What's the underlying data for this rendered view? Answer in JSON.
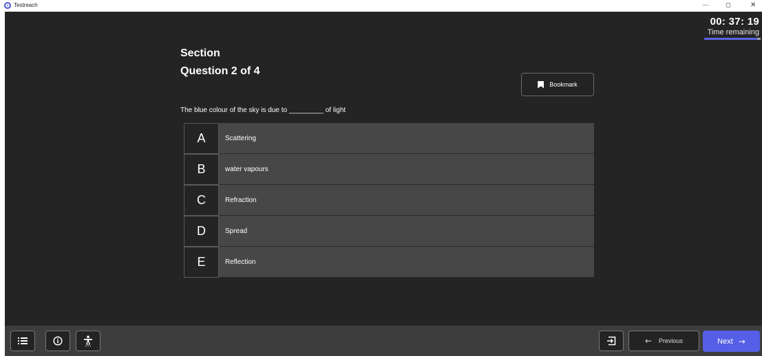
{
  "window": {
    "app_title": "Testreach",
    "minimize_glyph": "—",
    "maximize_glyph": "◻",
    "close_glyph": "✕"
  },
  "timer": {
    "value": "00: 37: 19",
    "label": "Time remaining",
    "progress_fraction": 0.94
  },
  "header": {
    "section": "Section",
    "question": "Question 2 of 4"
  },
  "bookmark": {
    "label": "Bookmark",
    "icon": "bookmark-icon"
  },
  "question": {
    "text": "The blue colour of the sky is due to _________ of light"
  },
  "options": [
    {
      "letter": "A",
      "text": "Scattering"
    },
    {
      "letter": "B",
      "text": "water vapours"
    },
    {
      "letter": "C",
      "text": "Refraction"
    },
    {
      "letter": "D",
      "text": "Spread"
    },
    {
      "letter": "E",
      "text": "Reflection"
    }
  ],
  "footer": {
    "list_icon": "list-icon",
    "info_icon": "info-icon",
    "accessibility_icon": "accessibility-icon",
    "exit_icon": "exit-icon",
    "previous_label": "Previous",
    "previous_arrow": "←",
    "next_label": "Next",
    "next_arrow": "→"
  },
  "colors": {
    "accent": "#555ee6",
    "panel": "#242424",
    "option_bg": "#474747",
    "footer_bg": "#3d3d3d"
  }
}
